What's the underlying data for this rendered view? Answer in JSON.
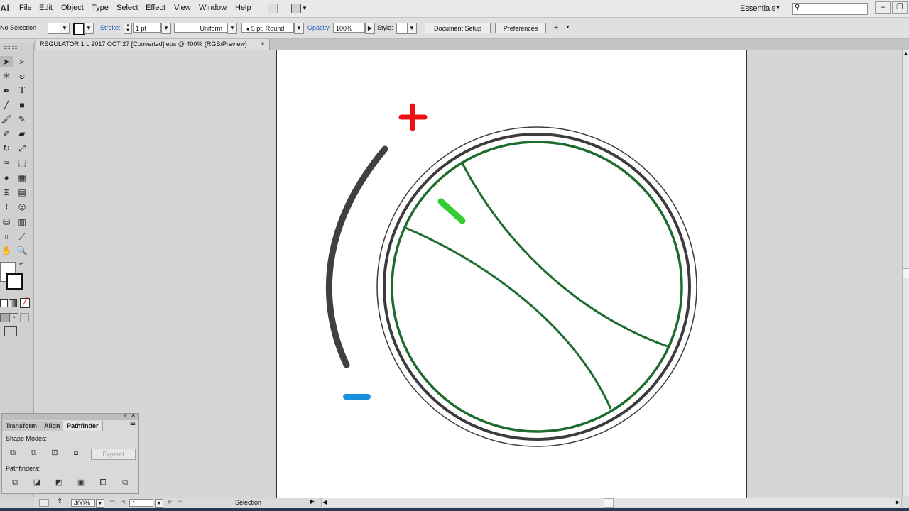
{
  "menubar": {
    "app_logo": "Ai",
    "items": [
      "File",
      "Edit",
      "Object",
      "Type",
      "Select",
      "Effect",
      "View",
      "Window",
      "Help"
    ],
    "workspace": "Essentials"
  },
  "controlbar": {
    "selection_label": "No Selection",
    "stroke_label": "Stroke:",
    "stroke_weight": "1 pt",
    "stroke_profile": "Uniform",
    "brush": "5 pt. Round",
    "opacity_label": "Opacity:",
    "opacity_value": "100%",
    "style_label": "Style:",
    "doc_setup": "Document Setup",
    "preferences": "Preferences"
  },
  "document": {
    "tab_title": "REGULATOR 1 L 2017 OCT 27 [Converted].eps @ 400% (RGB/Preview)",
    "tab_close": "×"
  },
  "pathfinder_panel": {
    "tabs": [
      "Transform",
      "Align",
      "Pathfinder"
    ],
    "active_tab": "Pathfinder",
    "shape_modes_label": "Shape Modes:",
    "pathfinders_label": "Pathfinders:",
    "expand_label": "Expand"
  },
  "statusbar": {
    "zoom": "400%",
    "page": "1",
    "tool": "Selection"
  },
  "colors": {
    "plus": "#ee1111",
    "minus": "#1a8fdc",
    "indicator": "#33cc33",
    "dial_ring": "#1e6b2e",
    "outer_ring": "#3c3c3c",
    "arc": "#404040"
  },
  "icons": {
    "tools": [
      "selection-icon",
      "direct-selection-icon",
      "magic-wand-icon",
      "lasso-icon",
      "pen-icon",
      "type-icon",
      "line-icon",
      "rectangle-icon",
      "paintbrush-icon",
      "pencil-icon",
      "blob-brush-icon",
      "eraser-icon",
      "rotate-icon",
      "scale-icon",
      "width-icon",
      "free-transform-icon",
      "shape-builder-icon",
      "perspective-grid-icon",
      "mesh-icon",
      "gradient-icon",
      "eyedropper-icon",
      "blend-icon",
      "symbol-sprayer-icon",
      "graph-icon",
      "artboard-icon",
      "slice-icon",
      "hand-icon",
      "zoom-icon"
    ]
  }
}
